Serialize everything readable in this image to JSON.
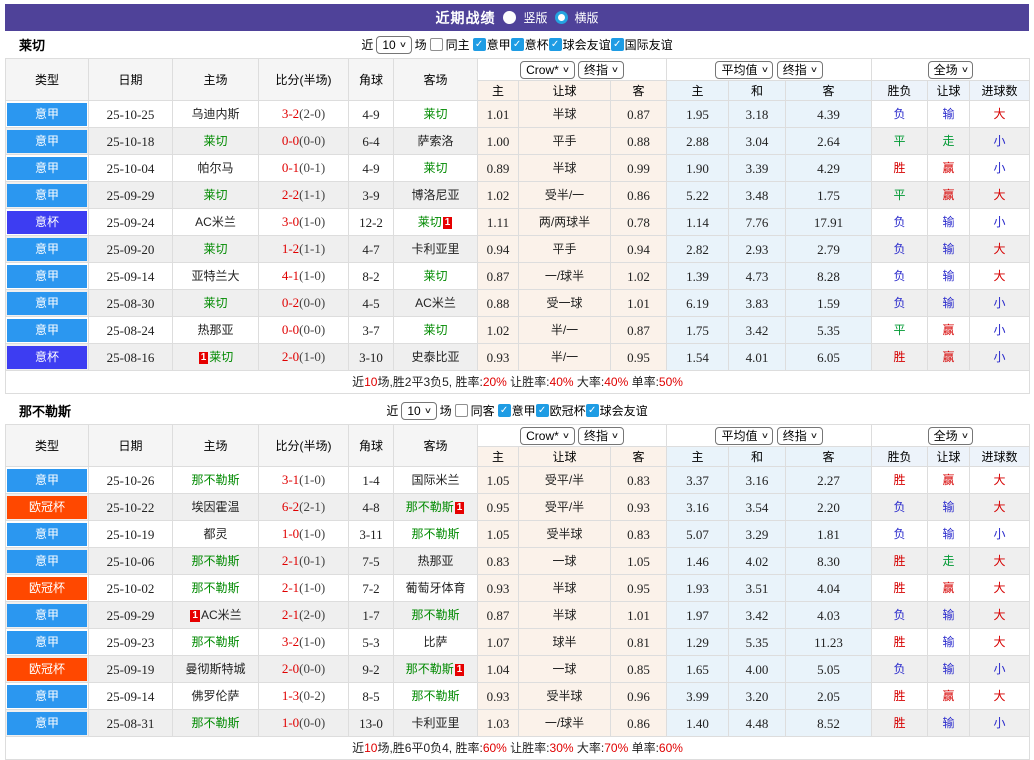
{
  "title": {
    "text": "近期战绩",
    "options": [
      {
        "label": "竖版",
        "selected": false
      },
      {
        "label": "横版",
        "selected": true
      }
    ]
  },
  "filter_labels": {
    "near": "近",
    "games": "场"
  },
  "columns": {
    "type": "类型",
    "date": "日期",
    "home": "主场",
    "score": "比分(半场)",
    "corner": "角球",
    "away": "客场",
    "h": "主",
    "handicap": "让球",
    "a": "客",
    "avg_h": "主",
    "avg_d": "和",
    "avg_a": "客",
    "wdl": "胜负",
    "hcp_result": "让球",
    "goals": "进球数",
    "dd_crow": "Crow*",
    "dd_final1": "终指",
    "dd_avg": "平均值",
    "dd_final2": "终指",
    "dd_fulltime": "全场"
  },
  "colors": {
    "titlebar_purple": "#4F4299",
    "score_red": "#E00000",
    "self_team_green": "#008A00",
    "card_red": "#E60000",
    "checkbox_blue": "#1E9CE4"
  },
  "league_colors": {
    "意甲": "#2B97F0",
    "意杯": "#3D3DF2",
    "欧冠杯": "#FF4800"
  },
  "result_colors": {
    "胜": "#D60000",
    "平": "#009933",
    "负": "#2A2ACC",
    "赢": "#D60000",
    "走": "#009933",
    "输": "#2A2ACC",
    "大": "#D60000",
    "小": "#2A2ACC"
  },
  "teams": [
    {
      "name": "莱切",
      "filter": {
        "count": "10",
        "same_label": "同主",
        "same_checked": false,
        "leagues": [
          {
            "label": "意甲",
            "checked": true
          },
          {
            "label": "意杯",
            "checked": true
          },
          {
            "label": "球会友谊",
            "checked": true
          },
          {
            "label": "国际友谊",
            "checked": true
          }
        ]
      },
      "rows": [
        {
          "league": "意甲",
          "date": "25-10-25",
          "home": {
            "name": "乌迪内斯"
          },
          "score": "3-2",
          "half": "(2-0)",
          "corner": "4-9",
          "away": {
            "name": "莱切",
            "self": true
          },
          "odds": [
            "1.01",
            "半球",
            "0.87"
          ],
          "avg": [
            "1.95",
            "3.18",
            "4.39"
          ],
          "result": [
            "负",
            "输",
            "大"
          ]
        },
        {
          "league": "意甲",
          "date": "25-10-18",
          "home": {
            "name": "莱切",
            "self": true
          },
          "score": "0-0",
          "half": "(0-0)",
          "corner": "6-4",
          "away": {
            "name": "萨索洛"
          },
          "odds": [
            "1.00",
            "平手",
            "0.88"
          ],
          "avg": [
            "2.88",
            "3.04",
            "2.64"
          ],
          "result": [
            "平",
            "走",
            "小"
          ]
        },
        {
          "league": "意甲",
          "date": "25-10-04",
          "home": {
            "name": "帕尔马"
          },
          "score": "0-1",
          "half": "(0-1)",
          "corner": "4-9",
          "away": {
            "name": "莱切",
            "self": true
          },
          "odds": [
            "0.89",
            "半球",
            "0.99"
          ],
          "avg": [
            "1.90",
            "3.39",
            "4.29"
          ],
          "result": [
            "胜",
            "赢",
            "小"
          ]
        },
        {
          "league": "意甲",
          "date": "25-09-29",
          "home": {
            "name": "莱切",
            "self": true
          },
          "score": "2-2",
          "half": "(1-1)",
          "corner": "3-9",
          "away": {
            "name": "博洛尼亚"
          },
          "odds": [
            "1.02",
            "受半/一",
            "0.86"
          ],
          "avg": [
            "5.22",
            "3.48",
            "1.75"
          ],
          "result": [
            "平",
            "赢",
            "大"
          ]
        },
        {
          "league": "意杯",
          "date": "25-09-24",
          "home": {
            "name": "AC米兰"
          },
          "score": "3-0",
          "half": "(1-0)",
          "corner": "12-2",
          "away": {
            "name": "莱切",
            "self": true,
            "card": true
          },
          "odds": [
            "1.11",
            "两/两球半",
            "0.78"
          ],
          "avg": [
            "1.14",
            "7.76",
            "17.91"
          ],
          "result": [
            "负",
            "输",
            "小"
          ]
        },
        {
          "league": "意甲",
          "date": "25-09-20",
          "home": {
            "name": "莱切",
            "self": true
          },
          "score": "1-2",
          "half": "(1-1)",
          "corner": "4-7",
          "away": {
            "name": "卡利亚里"
          },
          "odds": [
            "0.94",
            "平手",
            "0.94"
          ],
          "avg": [
            "2.82",
            "2.93",
            "2.79"
          ],
          "result": [
            "负",
            "输",
            "大"
          ]
        },
        {
          "league": "意甲",
          "date": "25-09-14",
          "home": {
            "name": "亚特兰大"
          },
          "score": "4-1",
          "half": "(1-0)",
          "corner": "8-2",
          "away": {
            "name": "莱切",
            "self": true
          },
          "odds": [
            "0.87",
            "一/球半",
            "1.02"
          ],
          "avg": [
            "1.39",
            "4.73",
            "8.28"
          ],
          "result": [
            "负",
            "输",
            "大"
          ]
        },
        {
          "league": "意甲",
          "date": "25-08-30",
          "home": {
            "name": "莱切",
            "self": true
          },
          "score": "0-2",
          "half": "(0-0)",
          "corner": "4-5",
          "away": {
            "name": "AC米兰"
          },
          "odds": [
            "0.88",
            "受一球",
            "1.01"
          ],
          "avg": [
            "6.19",
            "3.83",
            "1.59"
          ],
          "result": [
            "负",
            "输",
            "小"
          ]
        },
        {
          "league": "意甲",
          "date": "25-08-24",
          "home": {
            "name": "热那亚"
          },
          "score": "0-0",
          "half": "(0-0)",
          "corner": "3-7",
          "away": {
            "name": "莱切",
            "self": true
          },
          "odds": [
            "1.02",
            "半/一",
            "0.87"
          ],
          "avg": [
            "1.75",
            "3.42",
            "5.35"
          ],
          "result": [
            "平",
            "赢",
            "小"
          ]
        },
        {
          "league": "意杯",
          "date": "25-08-16",
          "home": {
            "name": "莱切",
            "self": true,
            "card": true
          },
          "score": "2-0",
          "half": "(1-0)",
          "corner": "3-10",
          "away": {
            "name": "史泰比亚"
          },
          "odds": [
            "0.93",
            "半/一",
            "0.95"
          ],
          "avg": [
            "1.54",
            "4.01",
            "6.05"
          ],
          "result": [
            "胜",
            "赢",
            "小"
          ]
        }
      ],
      "summary": [
        {
          "t": "近"
        },
        {
          "t": "10",
          "red": true
        },
        {
          "t": "场,胜2平3负5, 胜率:"
        },
        {
          "t": "20%",
          "red": true
        },
        {
          "t": " 让胜率:"
        },
        {
          "t": "40%",
          "red": true
        },
        {
          "t": " 大率:"
        },
        {
          "t": "40%",
          "red": true
        },
        {
          "t": " 单率:"
        },
        {
          "t": "50%",
          "red": true
        }
      ]
    },
    {
      "name": "那不勒斯",
      "filter": {
        "count": "10",
        "same_label": "同客",
        "same_checked": false,
        "leagues": [
          {
            "label": "意甲",
            "checked": true
          },
          {
            "label": "欧冠杯",
            "checked": true
          },
          {
            "label": "球会友谊",
            "checked": true
          }
        ]
      },
      "rows": [
        {
          "league": "意甲",
          "date": "25-10-26",
          "home": {
            "name": "那不勒斯",
            "self": true
          },
          "score": "3-1",
          "half": "(1-0)",
          "corner": "1-4",
          "away": {
            "name": "国际米兰"
          },
          "odds": [
            "1.05",
            "受平/半",
            "0.83"
          ],
          "avg": [
            "3.37",
            "3.16",
            "2.27"
          ],
          "result": [
            "胜",
            "赢",
            "大"
          ]
        },
        {
          "league": "欧冠杯",
          "date": "25-10-22",
          "home": {
            "name": "埃因霍温"
          },
          "score": "6-2",
          "half": "(2-1)",
          "corner": "4-8",
          "away": {
            "name": "那不勒斯",
            "self": true,
            "card": true
          },
          "odds": [
            "0.95",
            "受平/半",
            "0.93"
          ],
          "avg": [
            "3.16",
            "3.54",
            "2.20"
          ],
          "result": [
            "负",
            "输",
            "大"
          ]
        },
        {
          "league": "意甲",
          "date": "25-10-19",
          "home": {
            "name": "都灵"
          },
          "score": "1-0",
          "half": "(1-0)",
          "corner": "3-11",
          "away": {
            "name": "那不勒斯",
            "self": true
          },
          "odds": [
            "1.05",
            "受半球",
            "0.83"
          ],
          "avg": [
            "5.07",
            "3.29",
            "1.81"
          ],
          "result": [
            "负",
            "输",
            "小"
          ]
        },
        {
          "league": "意甲",
          "date": "25-10-06",
          "home": {
            "name": "那不勒斯",
            "self": true
          },
          "score": "2-1",
          "half": "(0-1)",
          "corner": "7-5",
          "away": {
            "name": "热那亚"
          },
          "odds": [
            "0.83",
            "一球",
            "1.05"
          ],
          "avg": [
            "1.46",
            "4.02",
            "8.30"
          ],
          "result": [
            "胜",
            "走",
            "大"
          ]
        },
        {
          "league": "欧冠杯",
          "date": "25-10-02",
          "home": {
            "name": "那不勒斯",
            "self": true
          },
          "score": "2-1",
          "half": "(1-0)",
          "corner": "7-2",
          "away": {
            "name": "葡萄牙体育"
          },
          "odds": [
            "0.93",
            "半球",
            "0.95"
          ],
          "avg": [
            "1.93",
            "3.51",
            "4.04"
          ],
          "result": [
            "胜",
            "赢",
            "大"
          ]
        },
        {
          "league": "意甲",
          "date": "25-09-29",
          "home": {
            "name": "AC米兰",
            "card": true
          },
          "score": "2-1",
          "half": "(2-0)",
          "corner": "1-7",
          "away": {
            "name": "那不勒斯",
            "self": true
          },
          "odds": [
            "0.87",
            "半球",
            "1.01"
          ],
          "avg": [
            "1.97",
            "3.42",
            "4.03"
          ],
          "result": [
            "负",
            "输",
            "大"
          ]
        },
        {
          "league": "意甲",
          "date": "25-09-23",
          "home": {
            "name": "那不勒斯",
            "self": true
          },
          "score": "3-2",
          "half": "(1-0)",
          "corner": "5-3",
          "away": {
            "name": "比萨"
          },
          "odds": [
            "1.07",
            "球半",
            "0.81"
          ],
          "avg": [
            "1.29",
            "5.35",
            "11.23"
          ],
          "result": [
            "胜",
            "输",
            "大"
          ]
        },
        {
          "league": "欧冠杯",
          "date": "25-09-19",
          "home": {
            "name": "曼彻斯特城"
          },
          "score": "2-0",
          "half": "(0-0)",
          "corner": "9-2",
          "away": {
            "name": "那不勒斯",
            "self": true,
            "card": true
          },
          "odds": [
            "1.04",
            "一球",
            "0.85"
          ],
          "avg": [
            "1.65",
            "4.00",
            "5.05"
          ],
          "result": [
            "负",
            "输",
            "小"
          ]
        },
        {
          "league": "意甲",
          "date": "25-09-14",
          "home": {
            "name": "佛罗伦萨"
          },
          "score": "1-3",
          "half": "(0-2)",
          "corner": "8-5",
          "away": {
            "name": "那不勒斯",
            "self": true
          },
          "odds": [
            "0.93",
            "受半球",
            "0.96"
          ],
          "avg": [
            "3.99",
            "3.20",
            "2.05"
          ],
          "result": [
            "胜",
            "赢",
            "大"
          ]
        },
        {
          "league": "意甲",
          "date": "25-08-31",
          "home": {
            "name": "那不勒斯",
            "self": true
          },
          "score": "1-0",
          "half": "(0-0)",
          "corner": "13-0",
          "away": {
            "name": "卡利亚里"
          },
          "odds": [
            "1.03",
            "一/球半",
            "0.86"
          ],
          "avg": [
            "1.40",
            "4.48",
            "8.52"
          ],
          "result": [
            "胜",
            "输",
            "小"
          ]
        }
      ],
      "summary": [
        {
          "t": "近"
        },
        {
          "t": "10",
          "red": true
        },
        {
          "t": "场,胜6平0负4, 胜率:"
        },
        {
          "t": "60%",
          "red": true
        },
        {
          "t": " 让胜率:"
        },
        {
          "t": "30%",
          "red": true
        },
        {
          "t": " 大率:"
        },
        {
          "t": "70%",
          "red": true
        },
        {
          "t": " 单率:"
        },
        {
          "t": "60%",
          "red": true
        }
      ]
    }
  ]
}
